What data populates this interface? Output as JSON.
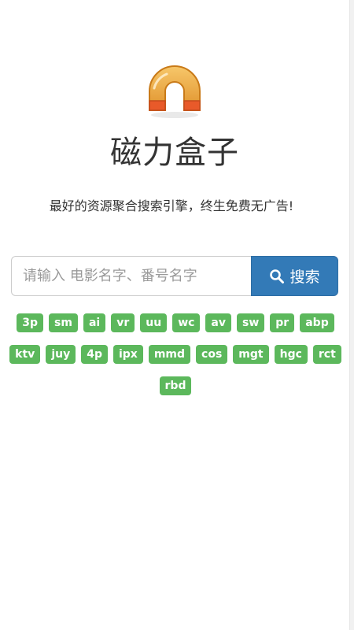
{
  "app": {
    "title": "磁力盒子",
    "slogan": "最好的资源聚合搜索引擎，终生免费无广告!"
  },
  "search": {
    "placeholder": "请输入 电影名字、番号名字",
    "button_label": "搜索",
    "icon": "search-icon"
  },
  "logo": {
    "icon": "magnet-icon",
    "colors": {
      "body_outer": "#e8a23a",
      "body_inner": "#f6c260",
      "tips": "#e85a2a",
      "border": "#c97a18"
    }
  },
  "colors": {
    "primary": "#337ab7",
    "tag": "#5cb85c",
    "text": "#333333"
  },
  "tags": [
    "3p",
    "sm",
    "ai",
    "vr",
    "uu",
    "wc",
    "av",
    "sw",
    "pr",
    "abp",
    "ktv",
    "juy",
    "4p",
    "ipx",
    "mmd",
    "cos",
    "mgt",
    "hgc",
    "rct",
    "rbd"
  ]
}
